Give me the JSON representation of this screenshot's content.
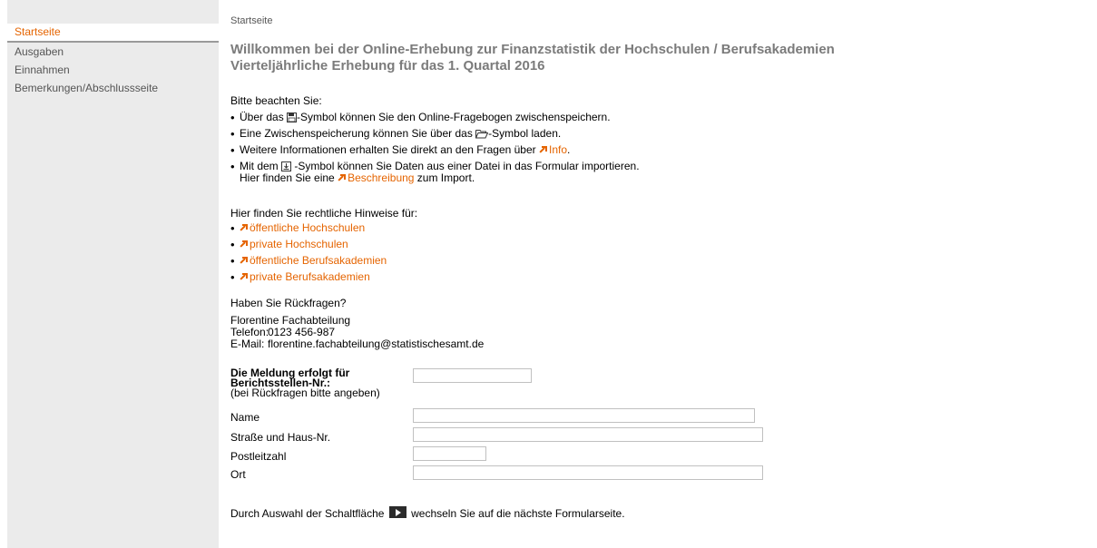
{
  "sidebar": {
    "items": [
      {
        "label": "Startseite",
        "active": true
      },
      {
        "label": "Ausgaben"
      },
      {
        "label": "Einnahmen"
      },
      {
        "label": "Bemerkungen/Abschlussseite"
      }
    ]
  },
  "breadcrumb": "Startseite",
  "title": {
    "line1": "Willkommen bei der Online-Erhebung zur Finanzstatistik der Hochschulen / Berufsakademien",
    "line2": "Vierteljährliche Erhebung für das 1. Quartal 2016"
  },
  "notes": {
    "heading": "Bitte beachten Sie:",
    "b1_pre": "Über das ",
    "b1_post": "-Symbol können Sie den Online-Fragebogen zwischenspeichern.",
    "b2_pre": "Eine Zwischenspeicherung können Sie über das ",
    "b2_post": "-Symbol laden.",
    "b3_pre": "Weitere Informationen erhalten Sie direkt an den Fragen über ",
    "b3_link": "Info",
    "b3_post": ".",
    "b4_pre": "Mit dem ",
    "b4_post": " -Symbol können Sie Daten aus einer Datei in das Formular importieren.",
    "b4_line2_pre": "Hier finden Sie eine ",
    "b4_line2_link": "Beschreibung",
    "b4_line2_post": " zum Import."
  },
  "legal": {
    "heading": "Hier finden Sie rechtliche Hinweise für:",
    "links": [
      "öffentliche Hochschulen",
      "private Hochschulen",
      "öffentliche Berufsakademien",
      "private Berufsakademien"
    ]
  },
  "contact": {
    "heading": "Haben Sie Rückfragen?",
    "name": "Florentine Fachabteilung",
    "phone_label": "Telefon:",
    "phone": "0123 456-987",
    "email_label": "E-Mail:",
    "email": "florentine.fachabteilung@statistischesamt.de"
  },
  "form": {
    "report_label_line1": "Die Meldung erfolgt für",
    "report_label_line2": "Berichtsstellen-Nr.:",
    "report_hint": "(bei Rückfragen bitte angeben)",
    "report_value": "",
    "name_label": "Name",
    "name_value": "",
    "street_label": "Straße und Haus-Nr.",
    "street_value": "",
    "zip_label": "Postleitzahl",
    "zip_value": "",
    "city_label": "Ort",
    "city_value": ""
  },
  "footer": {
    "pre": "Durch Auswahl der Schaltfläche ",
    "post": " wechseln Sie auf die nächste Formularseite."
  },
  "colors": {
    "accent": "#e56400",
    "title": "#7b7b7b",
    "sidebar_bg": "#ebebeb"
  }
}
